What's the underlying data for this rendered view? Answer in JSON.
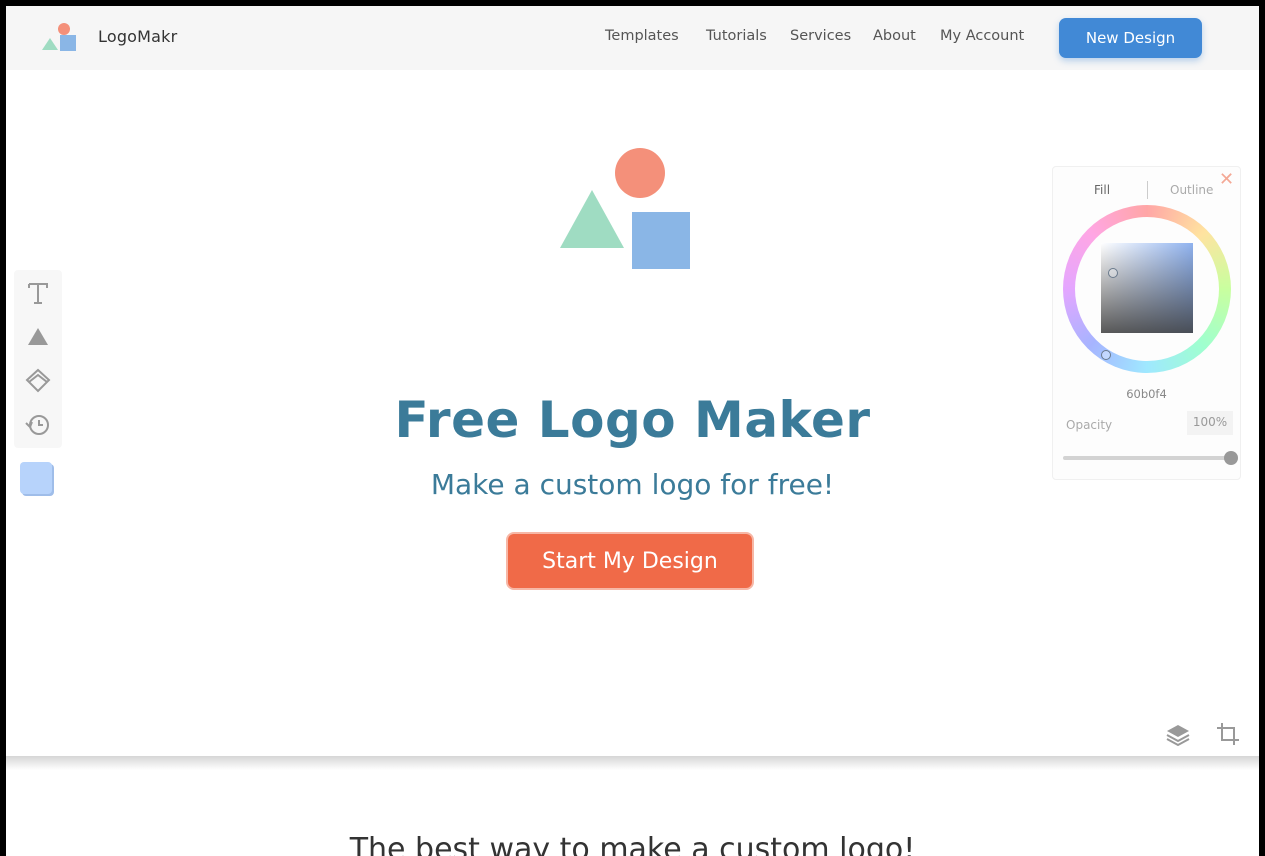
{
  "header": {
    "brand": "LogoMakr",
    "nav": [
      "Templates",
      "Tutorials",
      "Services",
      "About",
      "My Account"
    ],
    "cta_label": "New Design"
  },
  "hero": {
    "title": "Free Logo Maker",
    "subtitle": "Make a custom logo for free!",
    "cta_label": "Start My Design"
  },
  "color_picker": {
    "tabs": [
      "Fill",
      "Outline"
    ],
    "active_tab": "Fill",
    "close_icon": "close-icon",
    "hex": "60b0f4",
    "opacity_label": "Opacity",
    "opacity_value": "100%",
    "opacity_level": 1.0
  },
  "toolbar": {
    "tools": [
      "text-tool-icon",
      "shape-tool-icon",
      "eraser-tool-icon",
      "history-tool-icon"
    ],
    "swatch_color": "#b7d3fb"
  },
  "canvas_controls": [
    "layers-icon",
    "crop-icon"
  ],
  "next_section": {
    "title": "The best way to make a custom logo!"
  },
  "colors": {
    "accent_blue": "#4189d6",
    "cta_orange": "#f06a48",
    "title_teal": "#3b7b99",
    "logo_circle": "#f4907a",
    "logo_triangle": "#9fdcc2",
    "logo_square": "#8ab6e6"
  }
}
